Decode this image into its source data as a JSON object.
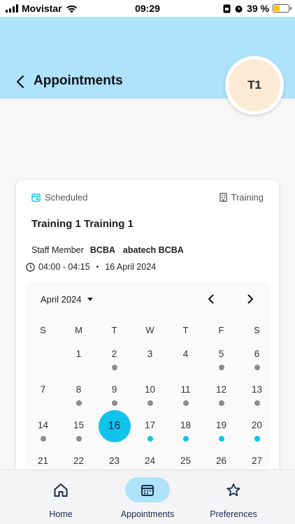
{
  "status_bar": {
    "carrier": "Movistar",
    "time": "09:29",
    "battery_percent": "39 %",
    "battery_level": 0.39
  },
  "header": {
    "title": "Appointments",
    "avatar_initials": "T1"
  },
  "appointment": {
    "status": "Scheduled",
    "type": "Training",
    "title": "Training 1 Training 1",
    "staff_label": "Staff Member",
    "staff_role": "BCBA",
    "staff_name": "abatech BCBA",
    "time_range": "04:00 - 04:15",
    "separator": "•",
    "date": "16 April 2024"
  },
  "calendar": {
    "month_label": "April 2024",
    "weekdays": [
      "S",
      "M",
      "T",
      "W",
      "T",
      "F",
      "S"
    ],
    "weeks": [
      [
        {
          "day": ""
        },
        {
          "day": "1"
        },
        {
          "day": "2",
          "dot": "gray"
        },
        {
          "day": "3"
        },
        {
          "day": "4"
        },
        {
          "day": "5",
          "dot": "gray"
        },
        {
          "day": "6",
          "dot": "gray"
        }
      ],
      [
        {
          "day": "7"
        },
        {
          "day": "8",
          "dot": "gray"
        },
        {
          "day": "9",
          "dot": "gray"
        },
        {
          "day": "10",
          "dot": "gray"
        },
        {
          "day": "11",
          "dot": "gray"
        },
        {
          "day": "12",
          "dot": "gray"
        },
        {
          "day": "13",
          "dot": "gray"
        }
      ],
      [
        {
          "day": "14",
          "dot": "gray"
        },
        {
          "day": "15",
          "dot": "gray"
        },
        {
          "day": "16",
          "selected": true
        },
        {
          "day": "17",
          "dot": "blue"
        },
        {
          "day": "18",
          "dot": "blue"
        },
        {
          "day": "19",
          "dot": "blue"
        },
        {
          "day": "20",
          "dot": "blue"
        }
      ],
      [
        {
          "day": "21"
        },
        {
          "day": "22"
        },
        {
          "day": "23"
        },
        {
          "day": "24"
        },
        {
          "day": "25"
        },
        {
          "day": "26"
        },
        {
          "day": "27"
        }
      ]
    ]
  },
  "bottom_nav": {
    "items": [
      {
        "label": "Home",
        "icon": "home-icon"
      },
      {
        "label": "Appointments",
        "icon": "calendar-icon",
        "active": true
      },
      {
        "label": "Preferences",
        "icon": "star-icon"
      }
    ]
  },
  "colors": {
    "header_bg": "#aee3fb",
    "accent": "#11c3ec",
    "dot_gray": "#8c8c8c",
    "avatar_bg": "#fdebd6"
  }
}
